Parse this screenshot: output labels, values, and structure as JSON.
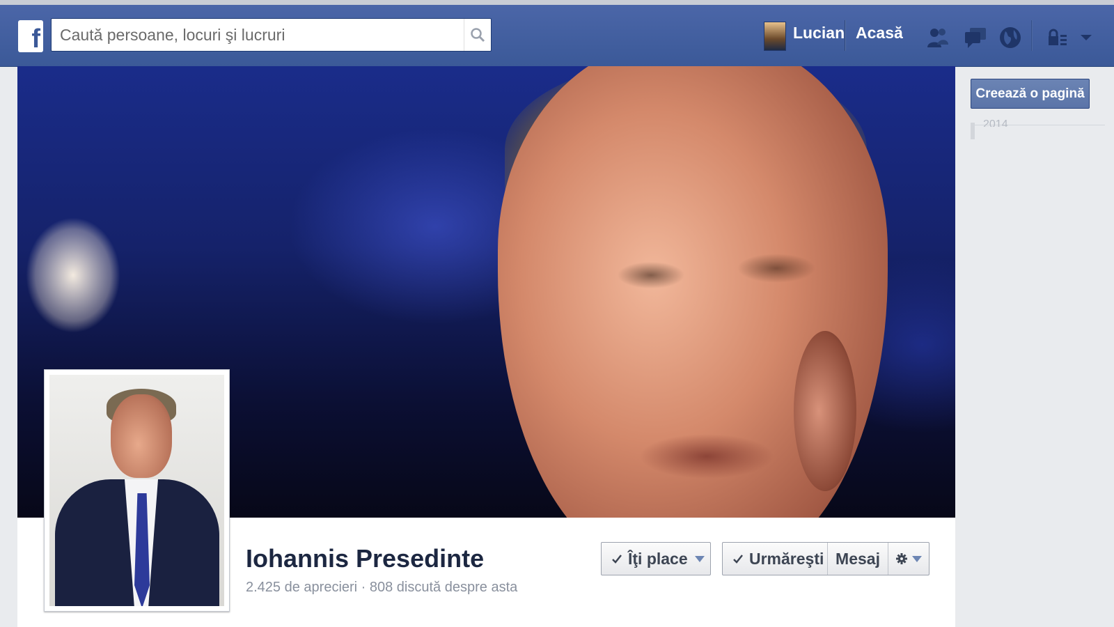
{
  "header": {
    "search_placeholder": "Caută persoane, locuri şi lucruri",
    "user_name": "Lucian",
    "home_label": "Acasă"
  },
  "page": {
    "name": "Iohannis Presedinte",
    "stats": "2.425 de aprecieri · 808 discută despre asta"
  },
  "actions": {
    "like_label": "Îţi place",
    "follow_label": "Urmăreşti",
    "message_label": "Mesaj"
  },
  "sidebar": {
    "create_page_label": "Creează o pagină",
    "timeline_year": "2014"
  },
  "colors": {
    "brand": "#3b5998",
    "header_bg": "#3b5998",
    "page_bg": "#e9ebee"
  },
  "icons": [
    "facebook-logo-icon",
    "search-icon",
    "friend-requests-icon",
    "messages-icon",
    "notifications-globe-icon",
    "privacy-shortcuts-icon",
    "account-menu-chevron-icon",
    "check-icon",
    "chevron-down-icon",
    "gear-icon"
  ]
}
